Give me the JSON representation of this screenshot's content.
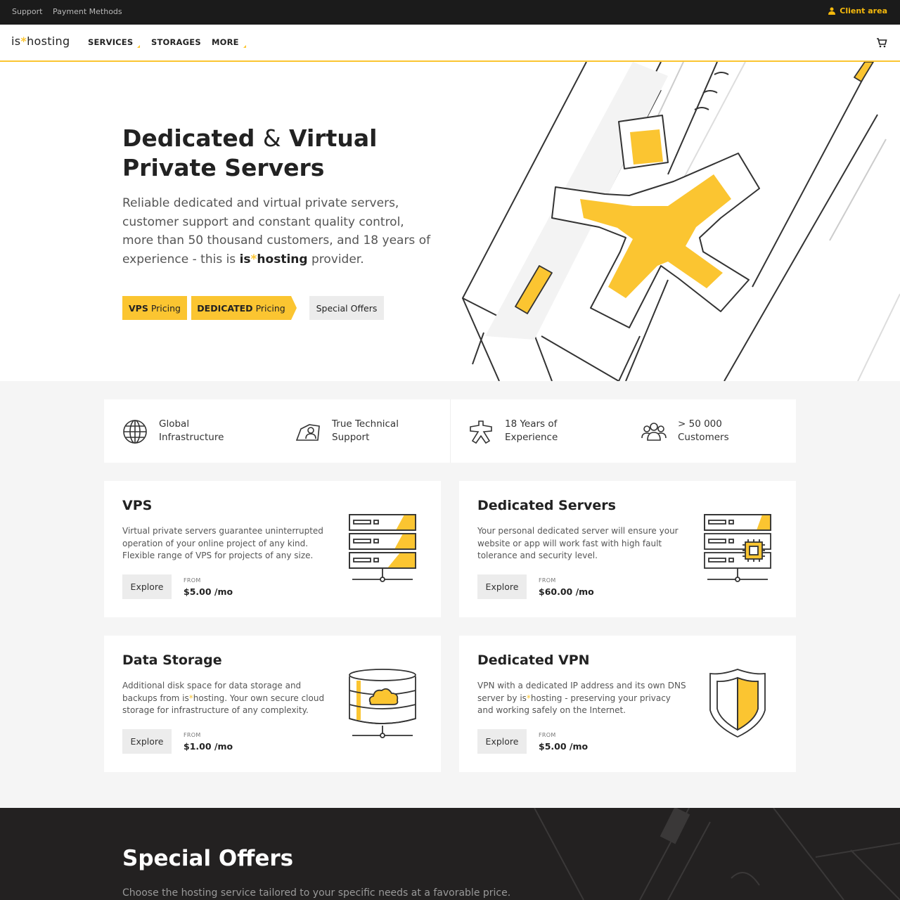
{
  "topbar": {
    "support": "Support",
    "payment_methods": "Payment Methods",
    "client_area": "Client area"
  },
  "nav": {
    "logo_left": "is",
    "logo_star": "*",
    "logo_right": "hosting",
    "services": "SERVICES",
    "storages": "STORAGES",
    "more": "MORE",
    "cart_icon": "cart-icon"
  },
  "hero": {
    "title_part1": "Dedicated ",
    "title_amp": "&",
    "title_part2": " Virtual",
    "title_line2": "Private Servers",
    "desc_main": "Reliable dedicated and virtual private servers, customer support and constant quality control, more than 50 thousand customers, and 18 years of experience - this is ",
    "desc_brand_left": "is",
    "desc_brand_star": "*",
    "desc_brand_right": "hosting",
    "desc_end": " provider.",
    "btn_vps_bold": "VPS",
    "btn_vps_rest": "Pricing",
    "btn_ded_bold": "DEDICATED",
    "btn_ded_rest": "Pricing",
    "btn_offers": "Special Offers"
  },
  "features": [
    {
      "line1": "Global",
      "line2": "Infrastructure",
      "icon": "globe-icon"
    },
    {
      "line1": "True Technical",
      "line2": "Support",
      "icon": "support-icon"
    },
    {
      "line1": "18 Years of",
      "line2": "Experience",
      "icon": "star-person-icon"
    },
    {
      "line1": "> 50 000",
      "line2": "Customers",
      "icon": "customers-icon"
    }
  ],
  "cards": {
    "vps": {
      "title": "VPS",
      "desc": "Virtual private servers guarantee uninterrupted operation of your online project of any kind. Flexible range of VPS for projects of any size.",
      "explore": "Explore",
      "from": "FROM",
      "price": "$5.00 /mo"
    },
    "dedicated": {
      "title": "Dedicated Servers",
      "desc": "Your personal dedicated server will ensure your website or app will work fast with high fault tolerance and security level.",
      "explore": "Explore",
      "from": "FROM",
      "price": "$60.00 /mo"
    },
    "storage": {
      "title": "Data Storage",
      "desc_1": "Additional disk space for data storage and backups from is",
      "desc_star": "*",
      "desc_2": "hosting. Your own secure cloud storage for infrastructure of any complexity.",
      "explore": "Explore",
      "from": "FROM",
      "price": "$1.00 /mo"
    },
    "vpn": {
      "title": "Dedicated VPN",
      "desc_1": "VPN with a dedicated IP address and its own DNS server by is",
      "desc_star": "*",
      "desc_2": "hosting - preserving your privacy and working safely on the Internet.",
      "explore": "Explore",
      "from": "FROM",
      "price": "$5.00 /mo"
    }
  },
  "offers": {
    "title": "Special Offers",
    "subtitle": "Choose the hosting service tailored to your specific needs at a favorable price."
  },
  "colors": {
    "accent": "#fbc531",
    "topbar": "#1b1b1b",
    "dark_section": "#232121"
  }
}
